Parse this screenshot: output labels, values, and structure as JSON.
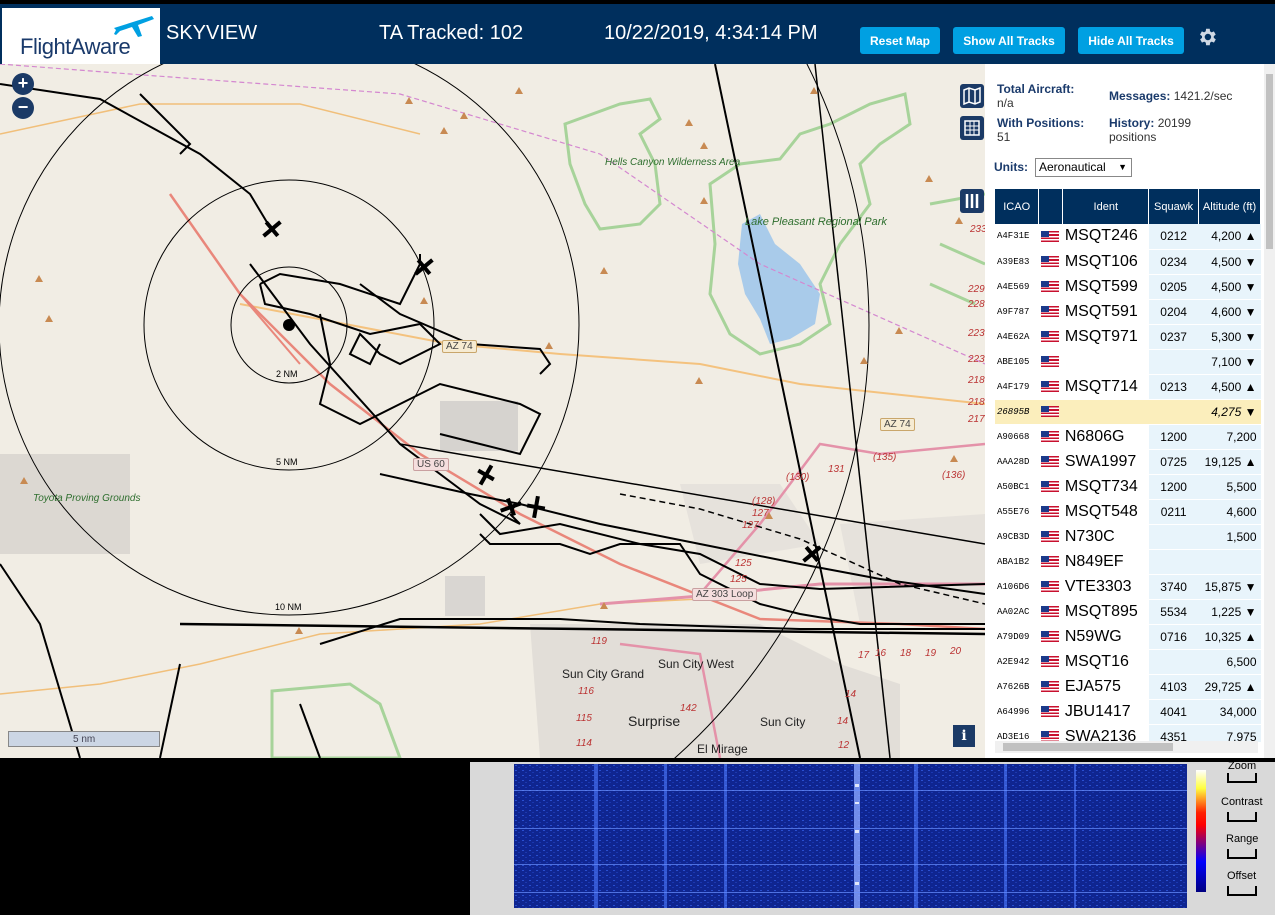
{
  "header": {
    "logo_text": "FlightAware",
    "site_name": "SKYVIEW",
    "tracked": "TA Tracked: 102",
    "datetime": "10/22/2019, 4:34:14 PM",
    "buttons": {
      "reset": "Reset Map",
      "show_all": "Show All Tracks",
      "hide_all": "Hide All Tracks"
    },
    "settings_icon": "gear-icon"
  },
  "map": {
    "zoom_in": "+",
    "zoom_out": "−",
    "range_rings": [
      "2 NM",
      "5 NM",
      "10 NM"
    ],
    "scale_label": "5 nm",
    "info_label": "i",
    "labels": {
      "hells_canyon": "Hells Canyon Wilderness Area",
      "lake_pleasant": "Lake Pleasant Regional Park",
      "toyota": "Toyota Proving Grounds",
      "sun_city_grand": "Sun City Grand",
      "sun_city_west": "Sun City West",
      "surprise": "Surprise",
      "sun_city": "Sun City",
      "el_mirage": "El Mirage"
    },
    "roads": {
      "az74_a": "AZ 74",
      "az74_b": "AZ 74",
      "us60": "US 60",
      "az303": "AZ 303 Loop"
    },
    "exit_numbers": [
      "(135)",
      "(136)",
      "(130)",
      "131",
      "(128)",
      "127",
      "127",
      "125",
      "125",
      "119",
      "116",
      "115",
      "114",
      "142",
      "14",
      "14",
      "12",
      "17",
      "16",
      "18",
      "19",
      "20",
      "233",
      "229",
      "228",
      "223",
      "223",
      "218",
      "218",
      "217"
    ]
  },
  "sidebar": {
    "total_aircraft_label": "Total Aircraft:",
    "total_aircraft_value": "n/a",
    "with_positions_label": "With Positions:",
    "with_positions_value": "51",
    "messages_label": "Messages:",
    "messages_value": "1421.2/sec",
    "history_label": "History:",
    "history_value": "20199",
    "history_unit": "positions",
    "units_label": "Units:",
    "units_value": "Aeronautical",
    "columns": [
      "ICAO",
      "",
      "Ident",
      "Squawk",
      "Altitude (ft)"
    ],
    "rows": [
      {
        "icao": "A4F31E",
        "ident": "MSQT246",
        "squawk": "0212",
        "alt": "4,200 ▲"
      },
      {
        "icao": "A39E83",
        "ident": "MSQT106",
        "squawk": "0234",
        "alt": "4,500 ▼"
      },
      {
        "icao": "A4E569",
        "ident": "MSQT599",
        "squawk": "0205",
        "alt": "4,500 ▼"
      },
      {
        "icao": "A9F787",
        "ident": "MSQT591",
        "squawk": "0204",
        "alt": "4,600 ▼"
      },
      {
        "icao": "A4E62A",
        "ident": "MSQT971",
        "squawk": "0237",
        "alt": "5,300 ▼"
      },
      {
        "icao": "ABE105",
        "ident": "",
        "squawk": "",
        "alt": "7,100 ▼"
      },
      {
        "icao": "A4F179",
        "ident": "MSQT714",
        "squawk": "0213",
        "alt": "4,500 ▲"
      },
      {
        "icao": "26895B",
        "ident": "",
        "squawk": "",
        "alt": "4,275 ▼",
        "selected": true
      },
      {
        "icao": "A90668",
        "ident": "N6806G",
        "squawk": "1200",
        "alt": "7,200"
      },
      {
        "icao": "AAA28D",
        "ident": "SWA1997",
        "squawk": "0725",
        "alt": "19,125 ▲"
      },
      {
        "icao": "A50BC1",
        "ident": "MSQT734",
        "squawk": "1200",
        "alt": "5,500"
      },
      {
        "icao": "A55E76",
        "ident": "MSQT548",
        "squawk": "0211",
        "alt": "4,600"
      },
      {
        "icao": "A9CB3D",
        "ident": "N730C",
        "squawk": "",
        "alt": "1,500"
      },
      {
        "icao": "ABA1B2",
        "ident": "N849EF",
        "squawk": "",
        "alt": ""
      },
      {
        "icao": "A106D6",
        "ident": "VTE3303",
        "squawk": "3740",
        "alt": "15,875 ▼"
      },
      {
        "icao": "AA02AC",
        "ident": "MSQT895",
        "squawk": "5534",
        "alt": "1,225 ▼"
      },
      {
        "icao": "A79D09",
        "ident": "N59WG",
        "squawk": "0716",
        "alt": "10,325 ▲"
      },
      {
        "icao": "A2E942",
        "ident": "MSQT16",
        "squawk": "",
        "alt": "6,500"
      },
      {
        "icao": "A7626B",
        "ident": "EJA575",
        "squawk": "4103",
        "alt": "29,725 ▲"
      },
      {
        "icao": "A64996",
        "ident": "JBU1417",
        "squawk": "4041",
        "alt": "34,000"
      },
      {
        "icao": "AD3E16",
        "ident": "SWA2136",
        "squawk": "4351",
        "alt": "7,975"
      }
    ]
  },
  "waterfall": {
    "zoom": "Zoom",
    "contrast": "Contrast",
    "range": "Range",
    "offset": "Offset"
  },
  "colors": {
    "header_bg": "#002f5d",
    "button_bg": "#00a0e2",
    "map_bg": "#f1ede4",
    "selected_row": "#fbeebc",
    "data_cell": "#e8f4fb"
  }
}
